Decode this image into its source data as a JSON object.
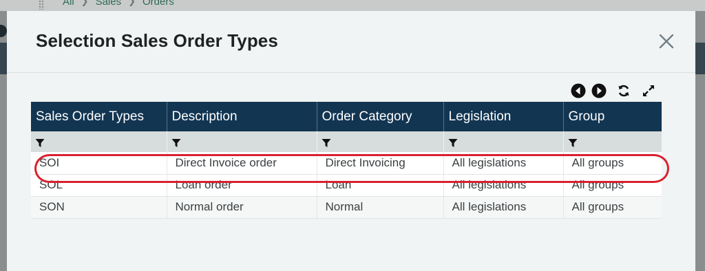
{
  "background": {
    "breadcrumb": [
      "All",
      "Sales",
      "Orders"
    ]
  },
  "modal": {
    "title": "Selection Sales Order Types",
    "close_icon": "close-icon",
    "toolbar": {
      "icons": [
        "previous-icon",
        "next-icon",
        "refresh-icon",
        "expand-icon"
      ]
    },
    "grid": {
      "columns": [
        "Sales Order Types",
        "Description",
        "Order Category",
        "Legislation",
        "Group"
      ],
      "rows": [
        [
          "SOI",
          "Direct Invoice order",
          "Direct Invoicing",
          "All legislations",
          "All groups"
        ],
        [
          "SOL",
          "Loan order",
          "Loan",
          "All legislations",
          "All groups"
        ],
        [
          "SON",
          "Normal order",
          "Normal",
          "All legislations",
          "All groups"
        ]
      ],
      "highlighted_row": "SOI"
    }
  },
  "colors": {
    "header_bg": "#123552",
    "filter_bg": "#d7dcdc",
    "highlight": "#d8212e",
    "modal_bg": "#f1f4f4"
  }
}
